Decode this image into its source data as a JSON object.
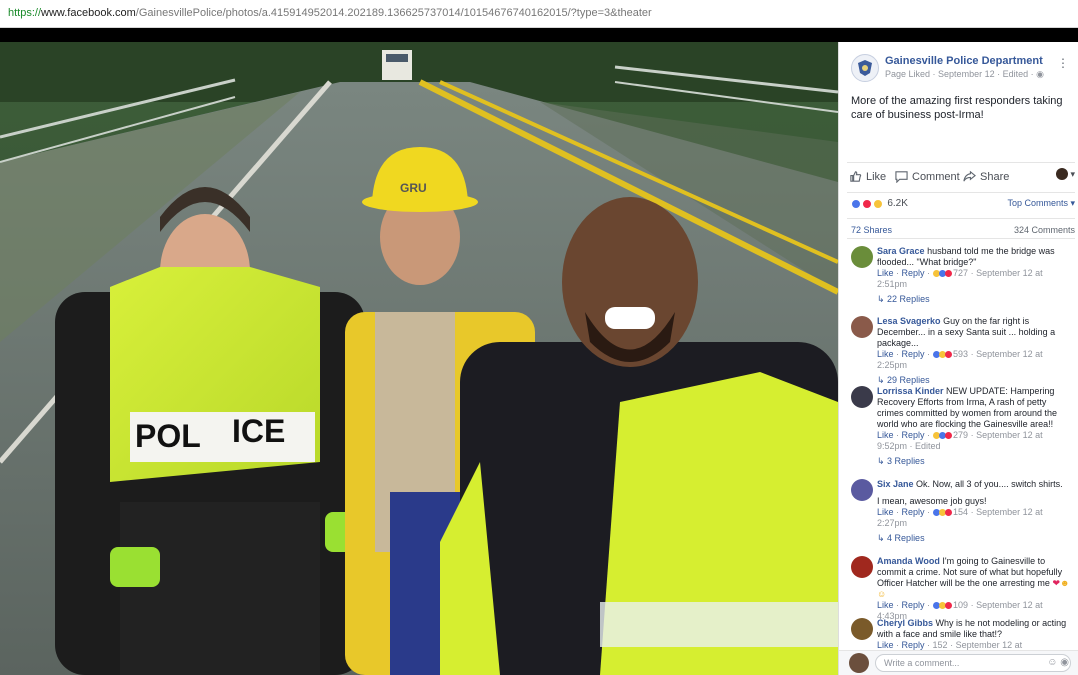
{
  "url": {
    "scheme": "https://",
    "host": "www.facebook.com",
    "path": "/GainesvillePolice/photos/a.415914952014.202189.136625737014/10154676740162015/?type=3&theater"
  },
  "post": {
    "page_name": "Gainesville Police Department",
    "status": "Page Liked",
    "date": "September 12",
    "edited": "Edited",
    "text": "More of the amazing first responders taking care of business post-Irma!",
    "actions": {
      "like": "Like",
      "comment": "Comment",
      "share": "Share"
    },
    "reaction_count": "6.2K",
    "top_comments": "Top Comments",
    "shares": "72 Shares",
    "comments_count": "324 Comments"
  },
  "photo": {
    "vest_text_left": "POL",
    "vest_text_right": "ICE",
    "hat_text": "GRU"
  },
  "comments": [
    {
      "name": "Sara Grace",
      "text": "husband told me the bridge was flooded... \"What bridge?\"",
      "actions": [
        "Like",
        "Reply"
      ],
      "reactions": "727",
      "time": "September 12 at 2:51pm",
      "edited": "",
      "replies": "22 Replies",
      "avatar_color": "#6a8d3a"
    },
    {
      "name": "Lesa Svagerko",
      "text": "Guy on the far right is December... in a sexy Santa suit ... holding a package...",
      "actions": [
        "Like",
        "Reply"
      ],
      "reactions": "593",
      "time": "September 12 at 2:25pm",
      "edited": "",
      "replies": "29 Replies",
      "avatar_color": "#8a5a4a"
    },
    {
      "name": "Lorrissa Kinder",
      "text": "NEW UPDATE: Hampering Recovery Efforts from Irma, A rash of petty crimes committed by women from around the world who are flocking the Gainesville area!!",
      "actions": [
        "Like",
        "Reply"
      ],
      "reactions": "279",
      "time": "September 12 at 9:52pm",
      "edited": "Edited",
      "replies": "3 Replies",
      "avatar_color": "#3a3a4a"
    },
    {
      "name": "Six Jane",
      "text": "Ok. Now, all 3 of you.... switch shirts.",
      "text2": "I mean, awesome job guys!",
      "actions": [
        "Like",
        "Reply"
      ],
      "reactions": "154",
      "time": "September 12 at 2:27pm",
      "edited": "",
      "replies": "4 Replies",
      "avatar_color": "#5a5aa0"
    },
    {
      "name": "Amanda Wood",
      "text": "I'm going to Gainesville to commit a crime. Not sure of what but hopefully Officer Hatcher will be the one arresting me",
      "actions": [
        "Like",
        "Reply"
      ],
      "reactions": "109",
      "time": "September 12 at 4:43pm",
      "edited": "",
      "replies": "",
      "avatar_color": "#a0281e"
    },
    {
      "name": "Cheryl Gibbs",
      "text": "Why is he not modeling or acting with a face and smile like that!?",
      "actions": [
        "Like",
        "Reply"
      ],
      "reactions": "152",
      "time": "September 12 at",
      "edited": "",
      "replies": "",
      "avatar_color": "#7a5a2a"
    }
  ],
  "composer": {
    "placeholder": "Write a comment..."
  }
}
